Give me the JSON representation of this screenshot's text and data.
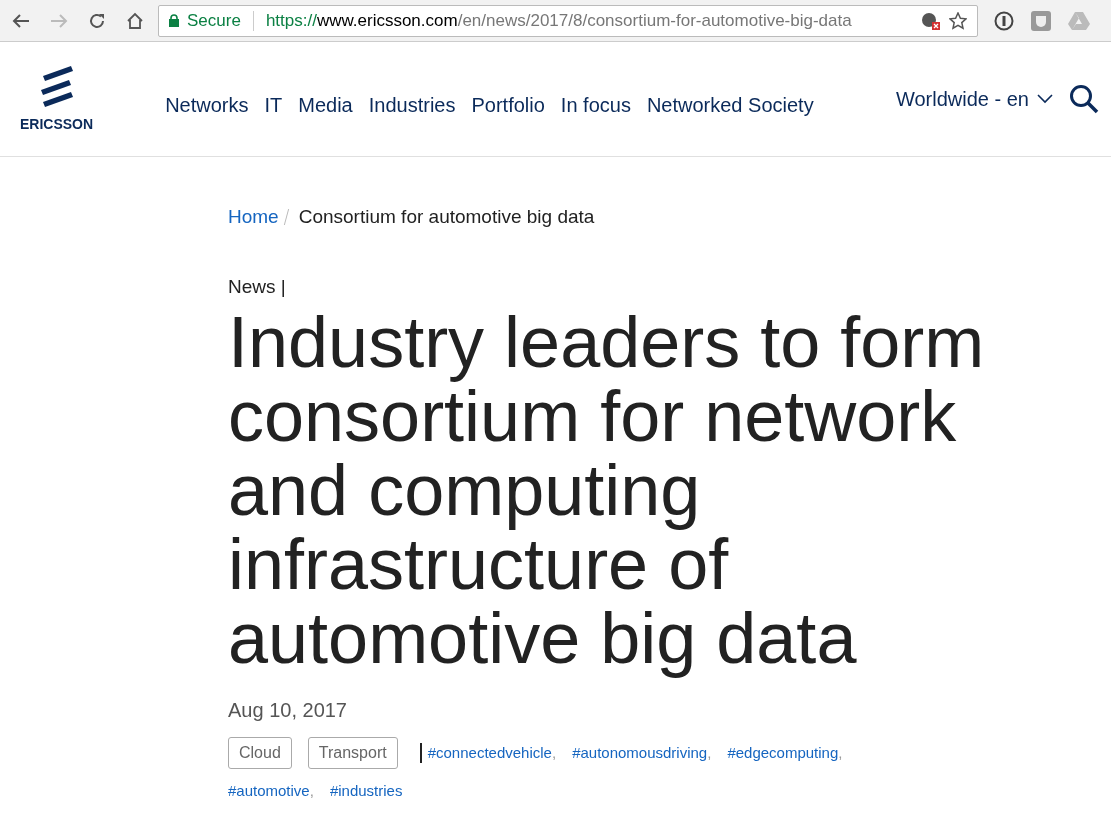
{
  "browser": {
    "security": "Secure",
    "url": {
      "scheme": "https://",
      "host": "www.ericsson.com",
      "path": "/en/news/2017/8/consortium-for-automotive-big-data"
    }
  },
  "site_header": {
    "logo_text": "ERICSSON",
    "nav": [
      "Networks",
      "IT",
      "Media",
      "Industries",
      "Portfolio",
      "In focus",
      "Networked Society"
    ],
    "locale": "Worldwide - en"
  },
  "breadcrumb": [
    {
      "label": "Home",
      "selected": false
    },
    {
      "label": "Consortium for automotive big data",
      "selected": true
    }
  ],
  "article": {
    "kicker": "News |",
    "headline": "Industry leaders to form consortium for network and computing infrastructure of automotive big data",
    "date": "Aug 10, 2017",
    "categories": [
      "Cloud",
      "Transport"
    ],
    "hashtags": [
      {
        "label": "#connectedvehicle",
        "separator": ","
      },
      {
        "label": "#autonomousdriving",
        "separator": ","
      },
      {
        "label": "#edgecomputing",
        "separator": ","
      },
      {
        "label": "#automotive",
        "separator": ","
      },
      {
        "label": "#industries"
      }
    ]
  }
}
